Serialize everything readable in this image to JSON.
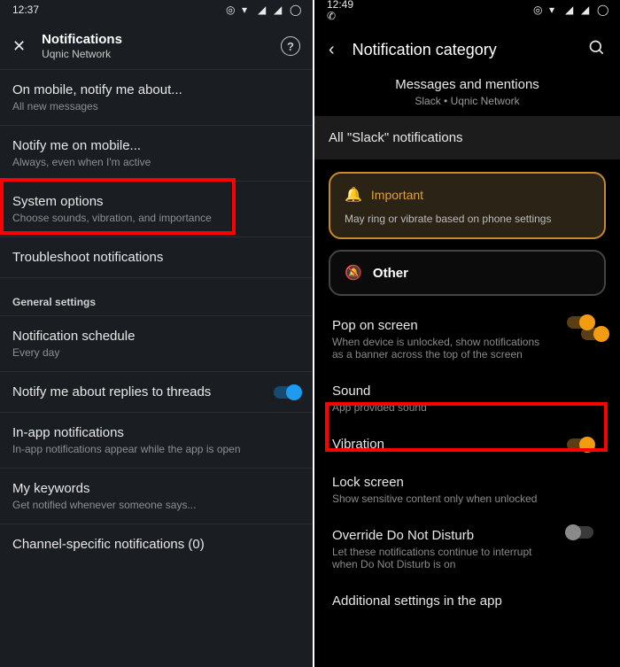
{
  "left": {
    "status": {
      "time": "12:37"
    },
    "header": {
      "title": "Notifications",
      "subtitle": "Uqnic Network"
    },
    "rows": {
      "mobile_about": {
        "pri": "On mobile, notify me about...",
        "sec": "All new messages"
      },
      "notify_mobile": {
        "pri": "Notify me on mobile...",
        "sec": "Always, even when I'm active"
      },
      "system": {
        "pri": "System options",
        "sec": "Choose sounds, vibration, and importance"
      },
      "troubleshoot": {
        "pri": "Troubleshoot notifications"
      },
      "section": "General settings",
      "schedule": {
        "pri": "Notification schedule",
        "sec": "Every day"
      },
      "threads": {
        "pri": "Notify me about replies to threads"
      },
      "inapp": {
        "pri": "In-app notifications",
        "sec": "In-app notifications appear while the app is open"
      },
      "keywords": {
        "pri": "My keywords",
        "sec": "Get notified whenever someone says..."
      },
      "channel": {
        "pri": "Channel-specific notifications (0)"
      }
    }
  },
  "right": {
    "status": {
      "time": "12:49"
    },
    "header": {
      "title": "Notification category"
    },
    "center": {
      "t1": "Messages and mentions",
      "t2": "Slack • Uqnic Network"
    },
    "bar": {
      "label": "All \"Slack\" notifications"
    },
    "cards": {
      "important": {
        "label": "Important",
        "sub": "May ring or vibrate based on phone settings"
      },
      "other": {
        "label": "Other"
      }
    },
    "settings": {
      "pop": {
        "pri": "Pop on screen",
        "sec": "When device is unlocked, show notifications as a banner across the top of the screen"
      },
      "sound": {
        "pri": "Sound",
        "sec": "App provided sound"
      },
      "vibration": {
        "pri": "Vibration"
      },
      "lock": {
        "pri": "Lock screen",
        "sec": "Show sensitive content only when unlocked"
      },
      "dnd": {
        "pri": "Override Do Not Disturb",
        "sec": "Let these notifications continue to interrupt when Do Not Disturb is on"
      },
      "additional": {
        "pri": "Additional settings in the app"
      }
    }
  }
}
